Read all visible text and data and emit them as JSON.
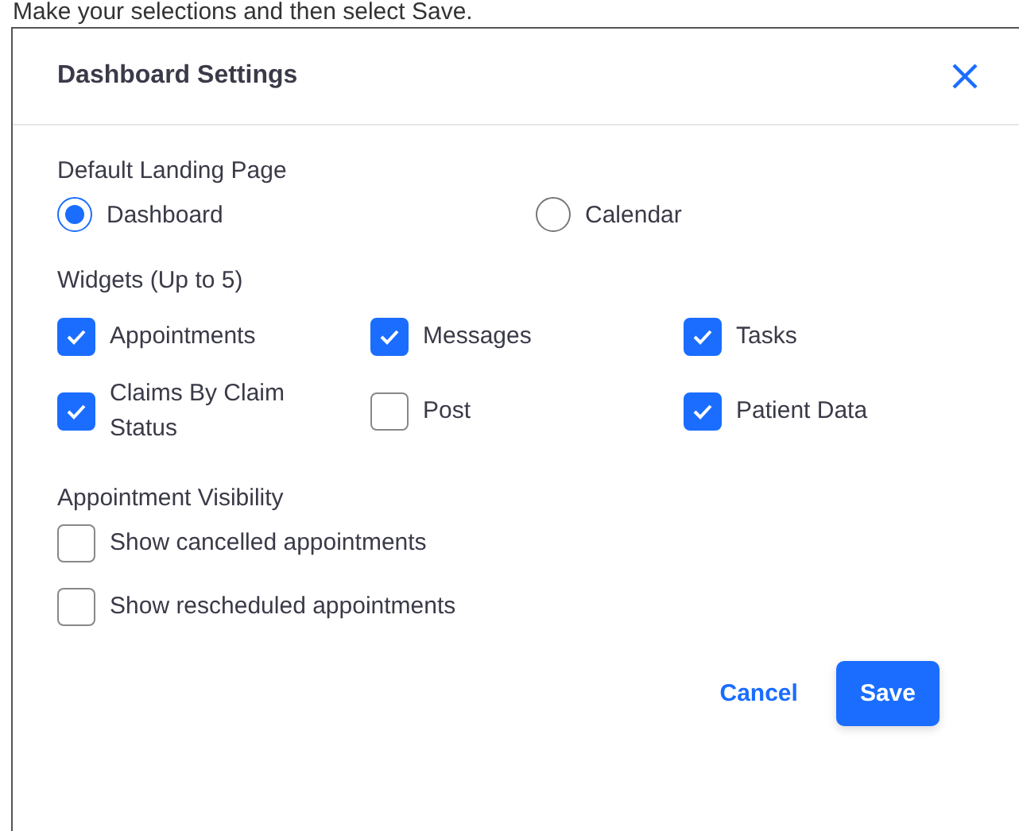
{
  "instruction": "Make your selections and then select Save.",
  "dialog": {
    "title": "Dashboard Settings",
    "landing": {
      "label": "Default Landing Page",
      "options": [
        {
          "label": "Dashboard",
          "selected": true
        },
        {
          "label": "Calendar",
          "selected": false
        }
      ]
    },
    "widgets": {
      "label": "Widgets (Up to 5)",
      "items": [
        {
          "label": "Appointments",
          "checked": true
        },
        {
          "label": "Messages",
          "checked": true
        },
        {
          "label": "Tasks",
          "checked": true
        },
        {
          "label": "Claims By Claim Status",
          "checked": true
        },
        {
          "label": "Post",
          "checked": false
        },
        {
          "label": "Patient Data",
          "checked": true
        }
      ]
    },
    "visibility": {
      "label": "Appointment Visibility",
      "items": [
        {
          "label": "Show cancelled appointments",
          "checked": false
        },
        {
          "label": "Show rescheduled appointments",
          "checked": false
        }
      ]
    },
    "buttons": {
      "cancel": "Cancel",
      "save": "Save"
    }
  }
}
